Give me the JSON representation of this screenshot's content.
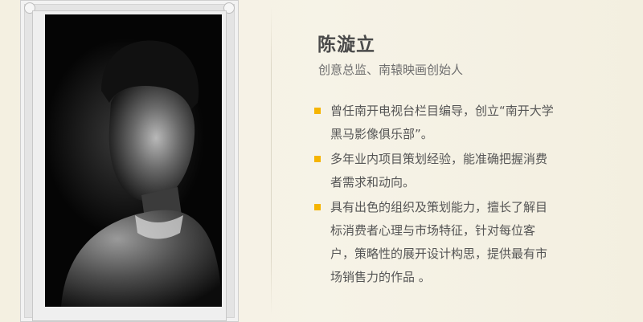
{
  "profile": {
    "name": "陈漩立",
    "title": "创意总监、南辕映画创始人"
  },
  "bullets": [
    {
      "text": "曾任南开电视台栏目编导，创立“南开大学黑马影像俱乐部”。"
    },
    {
      "text": "多年业内项目策划经验，能准确把握消费者需求和动向。"
    },
    {
      "text": "具有出色的组织及策划能力，擅长了解目标消费者心理与市场特征，针对每位客户，策略性的展开设计构思，提供最有市场销售力的作品 。"
    }
  ],
  "colors": {
    "background": "#f5f1e4",
    "bullet_accent": "#f5b400",
    "name_text": "#4a4a4a",
    "body_text": "#555555"
  },
  "icons": {
    "bullet": "square-bullet-icon"
  }
}
